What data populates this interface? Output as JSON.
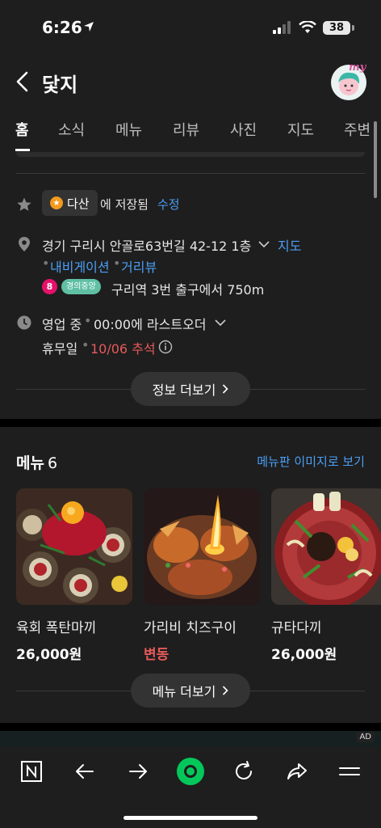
{
  "status_bar": {
    "time": "6:26",
    "battery": "38"
  },
  "header": {
    "title": "닻지"
  },
  "tabs": [
    {
      "label": "홈",
      "active": true
    },
    {
      "label": "소식"
    },
    {
      "label": "메뉴"
    },
    {
      "label": "리뷰"
    },
    {
      "label": "사진"
    },
    {
      "label": "지도"
    },
    {
      "label": "주변"
    }
  ],
  "saved": {
    "list_name": "다산",
    "text": "에 저장됨",
    "edit": "수정"
  },
  "address": {
    "text": "경기 구리시 안골로63번길 42-12 1층",
    "map_link": "지도",
    "navigation": "내비게이션",
    "street_view": "거리뷰"
  },
  "subway": {
    "line_number": "8",
    "line_name": "경의중앙",
    "directions": "구리역 3번 출구에서 750m"
  },
  "hours": {
    "status": "영업 중",
    "last_order": "00:00에 라스트오더",
    "closed_label": "휴무일",
    "closed_date": "10/06 추석"
  },
  "more_info": "정보 더보기",
  "menu": {
    "title": "메뉴",
    "count": "6",
    "image_link": "메뉴판 이미지로 보기",
    "items": [
      {
        "name": "육회 폭탄마끼",
        "price": "26,000원"
      },
      {
        "name": "가리비 치즈구이",
        "price": "변동"
      },
      {
        "name": "규타다끼",
        "price": "26,000원"
      }
    ],
    "more": "메뉴 더보기"
  },
  "ad_label": "AD",
  "colors": {
    "link": "#4b9ff5",
    "accent_green": "#03c75a",
    "holiday_red": "#e65a5a",
    "subway_line8": "#e4126a",
    "subway_gyeongui": "#5fc0a3"
  }
}
